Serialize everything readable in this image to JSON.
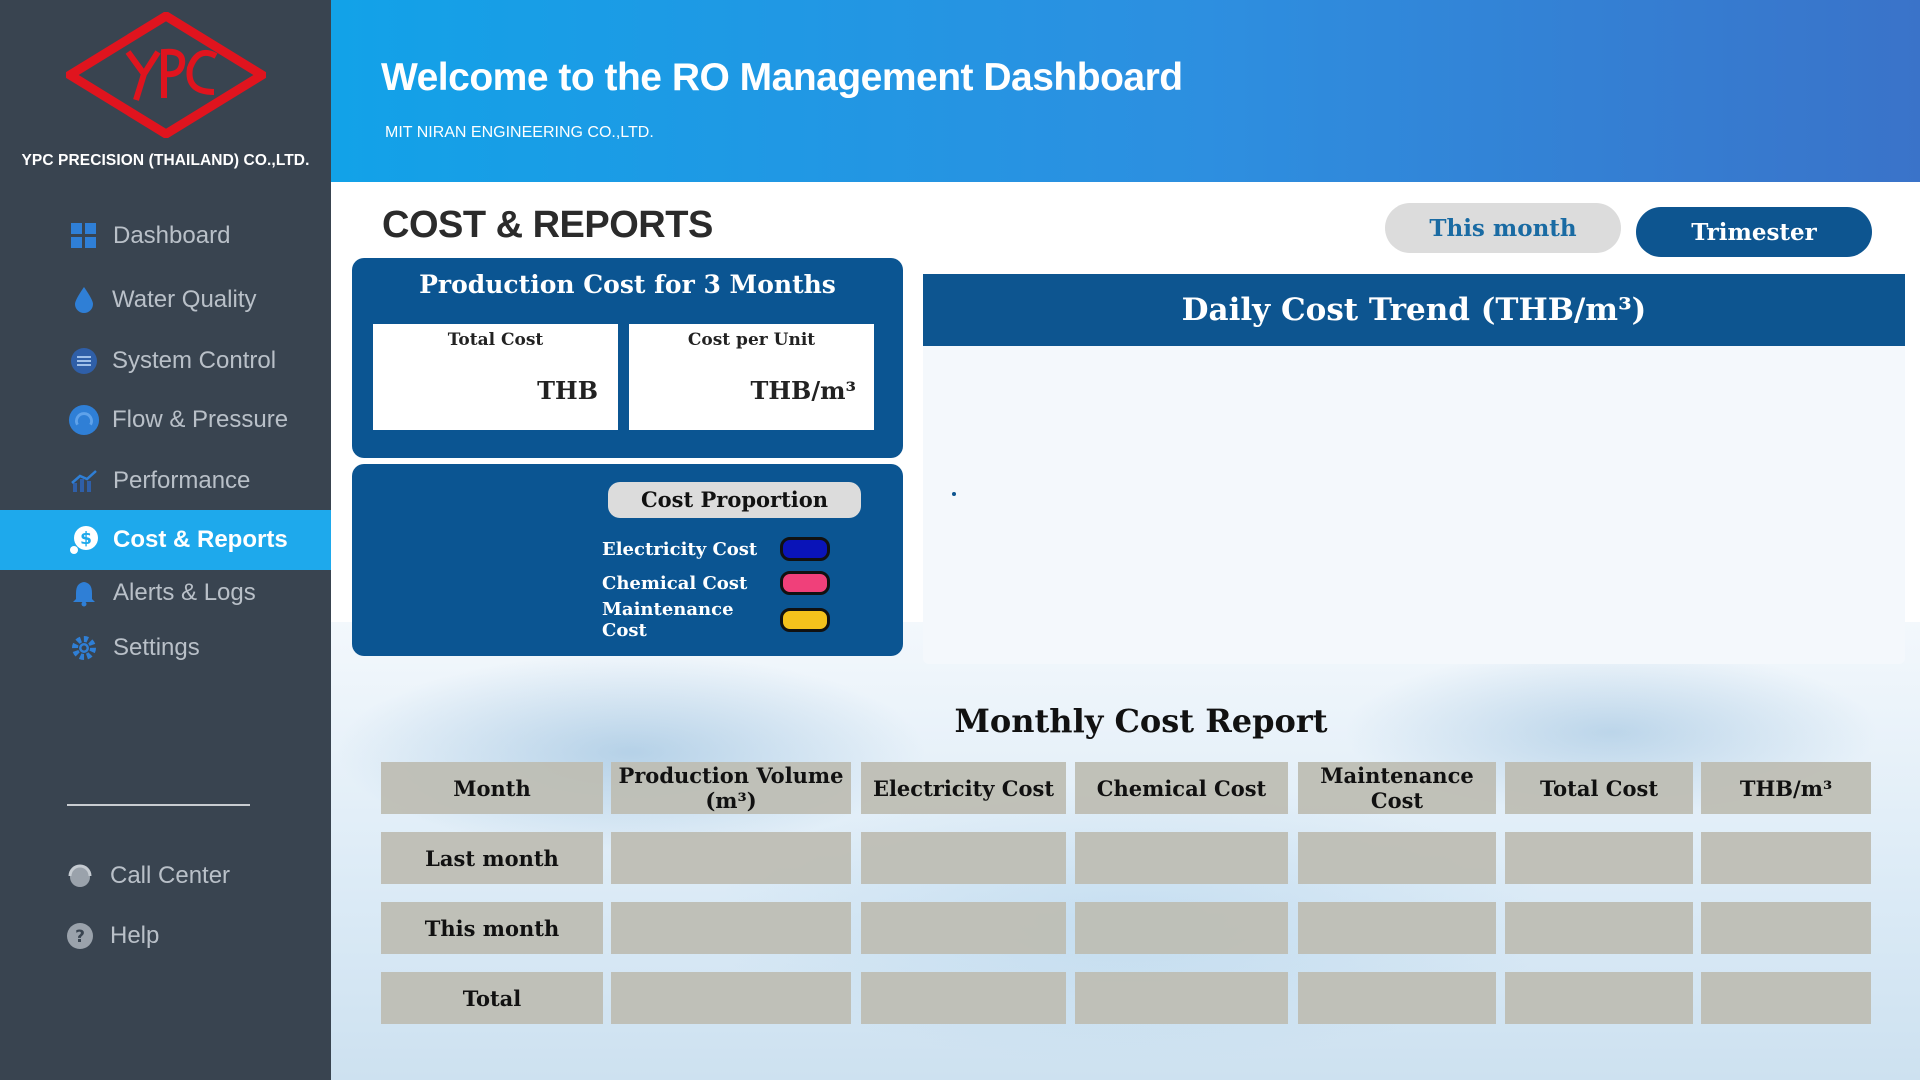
{
  "company": {
    "name": "YPC PRECISION (THAILAND) CO.,LTD.",
    "logo_text": "YPC"
  },
  "sidebar": {
    "items": [
      {
        "label": "Dashboard",
        "icon": "grid-icon",
        "active": false
      },
      {
        "label": "Water Quality",
        "icon": "water-drop-icon",
        "active": false
      },
      {
        "label": "System Control",
        "icon": "sliders-icon",
        "active": false
      },
      {
        "label": "Flow & Pressure",
        "icon": "gauge-icon",
        "active": false
      },
      {
        "label": "Performance",
        "icon": "trend-chart-icon",
        "active": false
      },
      {
        "label": "Cost & Reports",
        "icon": "dollar-coin-icon",
        "active": true
      },
      {
        "label": "Alerts & Logs",
        "icon": "bell-icon",
        "active": false
      },
      {
        "label": "Settings",
        "icon": "gear-icon",
        "active": false
      }
    ],
    "footer_items": [
      {
        "label": "Call Center",
        "icon": "headset-icon"
      },
      {
        "label": "Help",
        "icon": "question-icon"
      }
    ]
  },
  "header": {
    "title": "Welcome to the RO Management Dashboard",
    "subtitle": "MIT NIRAN ENGINEERING  CO.,LTD."
  },
  "page": {
    "title": "COST & REPORTS",
    "period_buttons": {
      "this_month": "This month",
      "trimester": "Trimester"
    }
  },
  "production_card": {
    "title": "Production Cost for 3 Months",
    "total_cost_label": "Total Cost",
    "total_cost_unit": "THB",
    "cost_per_unit_label": "Cost per Unit",
    "cost_per_unit_unit": "THB/m³"
  },
  "cost_proportion": {
    "title": "Cost Proportion",
    "legend": [
      {
        "label": "Electricity Cost",
        "color": "#0a14b8"
      },
      {
        "label": "Chemical Cost",
        "color": "#f0407a"
      },
      {
        "label": "Maintenance Cost",
        "color": "#f4c21c"
      }
    ]
  },
  "chart_data": {
    "type": "line",
    "title": "Daily Cost Trend (THB/m³)",
    "series": [],
    "colors": {
      "header": "#0d5590",
      "marker": "#0d5590"
    }
  },
  "report": {
    "title": "Monthly Cost Report",
    "columns": [
      "Month",
      "Production Volume (m³)",
      "Electricity Cost",
      "Chemical Cost",
      "Maintenance Cost",
      "Total Cost",
      "THB/m³"
    ],
    "rows": [
      {
        "label": "Last month",
        "values": [
          "",
          "",
          "",
          "",
          "",
          ""
        ]
      },
      {
        "label": "This month",
        "values": [
          "",
          "",
          "",
          "",
          "",
          ""
        ]
      },
      {
        "label": "Total",
        "values": [
          "",
          "",
          "",
          "",
          "",
          ""
        ]
      }
    ]
  },
  "colors": {
    "sidebar_bg": "#394450",
    "active_item": "#1ea9ec",
    "primary_dark": "#0b5592",
    "logo_red": "#e0141e"
  }
}
